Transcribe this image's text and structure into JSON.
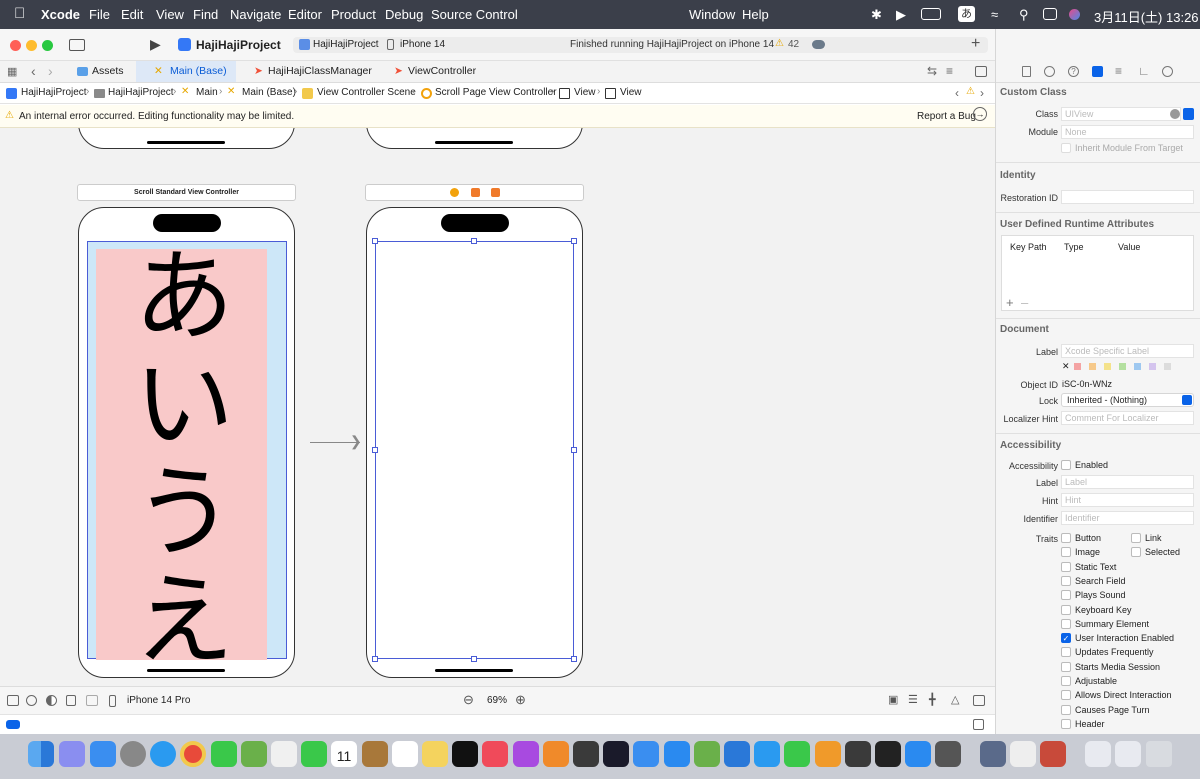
{
  "menubar": {
    "app": "Xcode",
    "items": [
      "File",
      "Edit",
      "View",
      "Find",
      "Navigate",
      "Editor",
      "Product",
      "Debug",
      "Source Control",
      "Window",
      "Help"
    ],
    "ime": "あ",
    "datetime": "3月11日(土)  13:26"
  },
  "toolbar": {
    "project": "HajiHajiProject",
    "scheme": "HajiHajiProject",
    "device": "iPhone 14",
    "status": "Finished running HajiHajiProject on iPhone 14",
    "warnings": "42"
  },
  "tabs": [
    "Assets",
    "Main (Base)",
    "HajiHajiClassManager",
    "ViewController"
  ],
  "breadcrumb": [
    "HajiHajiProject",
    "HajiHajiProject",
    "Main",
    "Main (Base)",
    "View Controller Scene",
    "Scroll Page View Controller",
    "View",
    "View"
  ],
  "error": {
    "message": "An internal error occurred. Editing functionality may be limited.",
    "report": "Report a Bug"
  },
  "canvas": {
    "scene_left_title": "Scroll Standard View Controller",
    "kana": [
      "あ",
      "い",
      "う",
      "え"
    ]
  },
  "bottombar": {
    "device": "iPhone 14 Pro",
    "zoom": "69%"
  },
  "inspector": {
    "custom_class": {
      "title": "Custom Class",
      "class_label": "Class",
      "class_placeholder": "UIView",
      "module_label": "Module",
      "module_placeholder": "None",
      "inherit": "Inherit Module From Target"
    },
    "identity": {
      "title": "Identity",
      "restoration_label": "Restoration ID"
    },
    "udra": {
      "title": "User Defined Runtime Attributes",
      "cols": [
        "Key Path",
        "Type",
        "Value"
      ]
    },
    "document": {
      "title": "Document",
      "label_label": "Label",
      "label_placeholder": "Xcode Specific Label",
      "objectid_label": "Object ID",
      "objectid": "iSC-0n-WNz",
      "lock_label": "Lock",
      "lock_value": "Inherited - (Nothing)",
      "hint_label": "Localizer Hint",
      "hint_placeholder": "Comment For Localizer"
    },
    "accessibility": {
      "title": "Accessibility",
      "acc_label": "Accessibility",
      "enabled": "Enabled",
      "label_label": "Label",
      "label_placeholder": "Label",
      "hint_label": "Hint",
      "hint_placeholder": "Hint",
      "identifier_label": "Identifier",
      "identifier_placeholder": "Identifier",
      "traits_label": "Traits",
      "traits_left": [
        "Button",
        "Image",
        "Static Text",
        "Search Field",
        "Plays Sound",
        "Keyboard Key",
        "Summary Element",
        "User Interaction Enabled",
        "Updates Frequently",
        "Starts Media Session",
        "Adjustable",
        "Allows Direct Interaction",
        "Causes Page Turn",
        "Header"
      ],
      "traits_right": [
        "Link",
        "Selected"
      ],
      "checked_trait": "User Interaction Enabled"
    }
  },
  "dock": {
    "calendar_day": "11"
  },
  "colors": {
    "accent": "#0a63e8",
    "pink": "#f9c9c9",
    "lightblue": "#cde7f8",
    "selection": "#4a5cd6"
  }
}
